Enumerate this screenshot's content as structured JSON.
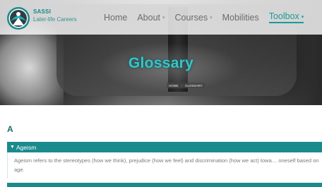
{
  "brand": {
    "name": "SASSI",
    "tagline": "Later-life Careers"
  },
  "nav": {
    "items": [
      {
        "label": "Home",
        "dropdown": false,
        "active": false
      },
      {
        "label": "About",
        "dropdown": true,
        "active": false
      },
      {
        "label": "Courses",
        "dropdown": true,
        "active": false
      },
      {
        "label": "Mobilities",
        "dropdown": false,
        "active": false
      },
      {
        "label": "Toolbox",
        "dropdown": true,
        "active": true
      }
    ],
    "caret_icon": "chevron-down-icon"
  },
  "hero": {
    "title": "Glossary",
    "breadcrumb": {
      "home": "HOME",
      "separator": "›",
      "current": "GLOSSARY"
    }
  },
  "glossary": {
    "letter": "A",
    "entries": [
      {
        "term": "Ageism",
        "expanded": true,
        "definition": "Ageism refers to the stereotypes (how we think), prejudice (how we feel) and discrimination (how we act) towa… oneself based on age."
      }
    ]
  },
  "colors": {
    "accent": "#1a8b8d",
    "title_glow": "#3cc3c5",
    "nav_text": "#6c6c6c",
    "body_text": "#7a7a7a"
  }
}
